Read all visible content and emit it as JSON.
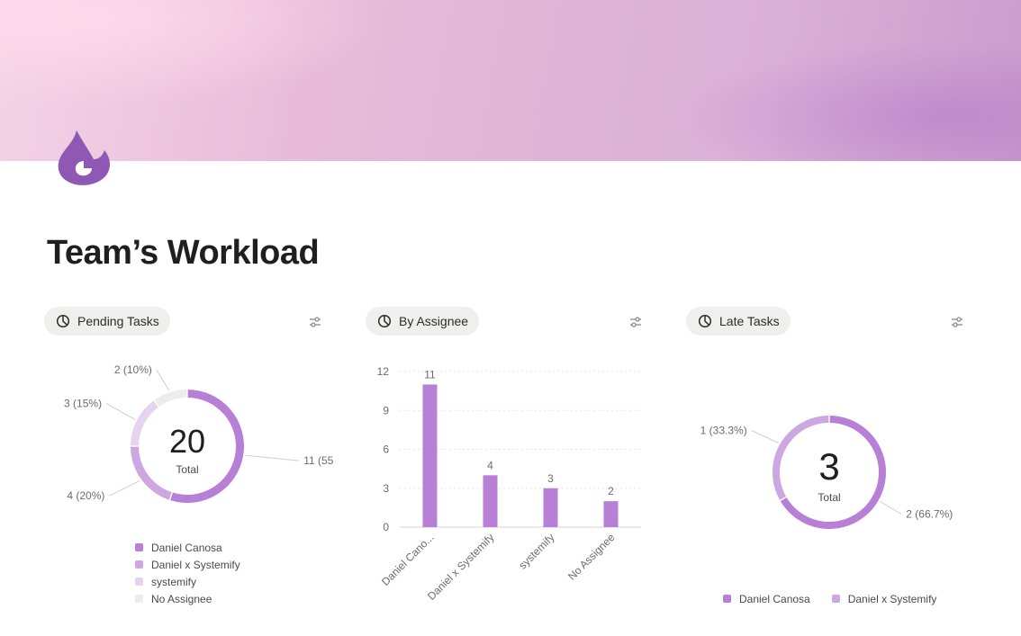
{
  "page": {
    "title": "Team’s Workload"
  },
  "colors": {
    "accent": "#b77fd6",
    "medium": "#cda7e2",
    "light": "#e5d3f0",
    "neutral": "#ececec"
  },
  "widgets": {
    "pending": {
      "label": "Pending Tasks"
    },
    "assignee": {
      "label": "By Assignee"
    },
    "late": {
      "label": "Late Tasks"
    }
  },
  "chart_data": [
    {
      "type": "pie",
      "title": "Pending Tasks",
      "total": 20,
      "total_label": "Total",
      "slices": [
        {
          "name": "Daniel Canosa",
          "value": 11,
          "label": "11 (55..."
        },
        {
          "name": "Daniel x Systemify",
          "value": 4,
          "label": "4 (20%)"
        },
        {
          "name": "systemify",
          "value": 3,
          "label": "3 (15%)"
        },
        {
          "name": "No Assignee",
          "value": 2,
          "label": "2 (10%)"
        }
      ],
      "legend": [
        "Daniel Canosa",
        "Daniel x Systemify",
        "systemify",
        "No Assignee"
      ]
    },
    {
      "type": "bar",
      "title": "By Assignee",
      "categories": [
        "Daniel Cano...",
        "Daniel x Systemify",
        "systemify",
        "No Assignee"
      ],
      "values": [
        11,
        4,
        3,
        2
      ],
      "ylim": [
        0,
        12
      ],
      "yticks": [
        0,
        3,
        6,
        9,
        12
      ],
      "grid": true
    },
    {
      "type": "pie",
      "title": "Late Tasks",
      "total": 3,
      "total_label": "Total",
      "slices": [
        {
          "name": "Daniel Canosa",
          "value": 2,
          "label": "2 (66.7%)"
        },
        {
          "name": "Daniel x Systemify",
          "value": 1,
          "label": "1 (33.3%)"
        }
      ],
      "legend": [
        "Daniel Canosa",
        "Daniel x Systemify"
      ]
    }
  ]
}
